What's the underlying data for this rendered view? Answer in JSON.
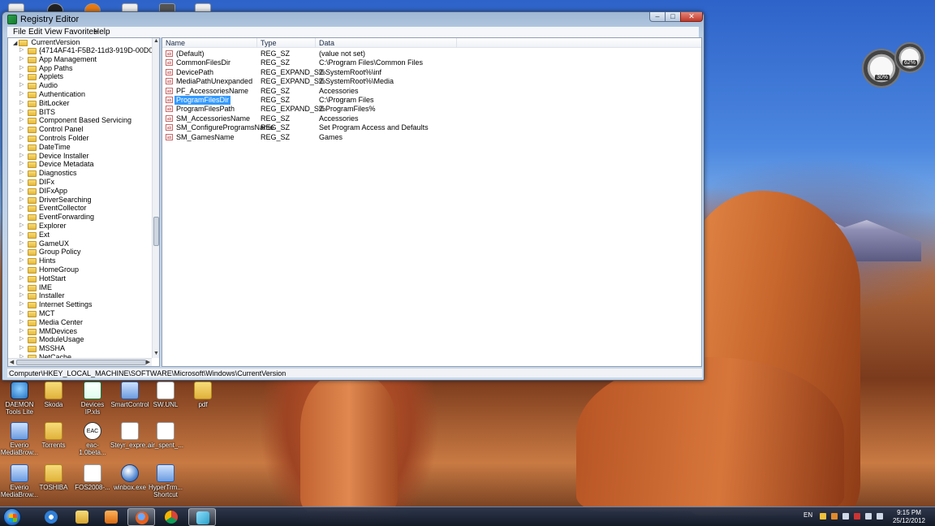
{
  "window": {
    "title": "Registry Editor",
    "controls": {
      "minimize": "–",
      "maximize": "□",
      "close": "✕"
    }
  },
  "menu": [
    "File",
    "Edit",
    "View",
    "Favorites",
    "Help"
  ],
  "tree": {
    "root": "CurrentVersion",
    "items": [
      "{4714AF41-F5B2-11d3-919D-00D0871030AD}",
      "App Management",
      "App Paths",
      "Applets",
      "Audio",
      "Authentication",
      "BitLocker",
      "BITS",
      "Component Based Servicing",
      "Control Panel",
      "Controls Folder",
      "DateTime",
      "Device Installer",
      "Device Metadata",
      "Diagnostics",
      "DIFx",
      "DIFxApp",
      "DriverSearching",
      "EventCollector",
      "EventForwarding",
      "Explorer",
      "Ext",
      "GameUX",
      "Group Policy",
      "Hints",
      "HomeGroup",
      "HotStart",
      "IME",
      "Installer",
      "Internet Settings",
      "MCT",
      "Media Center",
      "MMDevices",
      "ModuleUsage",
      "MSSHA",
      "NetCache"
    ]
  },
  "columns": {
    "name": "Name",
    "type": "Type",
    "data": "Data"
  },
  "values": [
    {
      "name": "(Default)",
      "type": "REG_SZ",
      "data": "(value not set)"
    },
    {
      "name": "CommonFilesDir",
      "type": "REG_SZ",
      "data": "C:\\Program Files\\Common Files"
    },
    {
      "name": "DevicePath",
      "type": "REG_EXPAND_SZ",
      "data": "%SystemRoot%\\inf"
    },
    {
      "name": "MediaPathUnexpanded",
      "type": "REG_EXPAND_SZ",
      "data": "%SystemRoot%\\Media"
    },
    {
      "name": "PF_AccessoriesName",
      "type": "REG_SZ",
      "data": "Accessories"
    },
    {
      "name": "ProgramFilesDir",
      "type": "REG_SZ",
      "data": "C:\\Program Files"
    },
    {
      "name": "ProgramFilesPath",
      "type": "REG_EXPAND_SZ",
      "data": "%ProgramFiles%"
    },
    {
      "name": "SM_AccessoriesName",
      "type": "REG_SZ",
      "data": "Accessories"
    },
    {
      "name": "SM_ConfigureProgramsName",
      "type": "REG_SZ",
      "data": "Set Program Access and Defaults"
    },
    {
      "name": "SM_GamesName",
      "type": "REG_SZ",
      "data": "Games"
    }
  ],
  "selected_value": "ProgramFilesDir",
  "status_path": "Computer\\HKEY_LOCAL_MACHINE\\SOFTWARE\\Microsoft\\Windows\\CurrentVersion",
  "desktop_icons": [
    {
      "label": "DAEMON Tools Lite",
      "kind": "daemon"
    },
    {
      "label": "Skoda",
      "kind": "folder"
    },
    {
      "label": "Devices IP.xls",
      "kind": "excel"
    },
    {
      "label": "SmartControl",
      "kind": "app"
    },
    {
      "label": "SW.UNL",
      "kind": "doc"
    },
    {
      "label": "pdf",
      "kind": "folder"
    },
    {
      "label": "Everio MediaBrow...",
      "kind": "app"
    },
    {
      "label": "Torrents",
      "kind": "folder"
    },
    {
      "label": "eac-1.0beta...",
      "kind": "eac"
    },
    {
      "label": "Steyr_expre...",
      "kind": "doc"
    },
    {
      "label": "air_spent_...",
      "kind": "doc"
    },
    {
      "label": "Everio MediaBrow...",
      "kind": "app"
    },
    {
      "label": "TOSHIBA",
      "kind": "folder"
    },
    {
      "label": "FOS2008-...",
      "kind": "doc"
    },
    {
      "label": "winbox.exe",
      "kind": "round"
    },
    {
      "label": "HyperTrm... Shortcut",
      "kind": "app"
    }
  ],
  "eac_text": "EAC",
  "gadget": {
    "cpu": "30%",
    "ram": "62%"
  },
  "taskbar": {
    "language": "EN",
    "time": "9:15 PM",
    "date": "25/12/2012",
    "pinned": [
      "internet-explorer",
      "file-explorer",
      "media-player",
      "firefox",
      "chrome",
      "regedit"
    ]
  },
  "colors": {
    "selection": "#3399ff",
    "window_frame": "#b9cde4",
    "close_button": "#c0392b"
  }
}
